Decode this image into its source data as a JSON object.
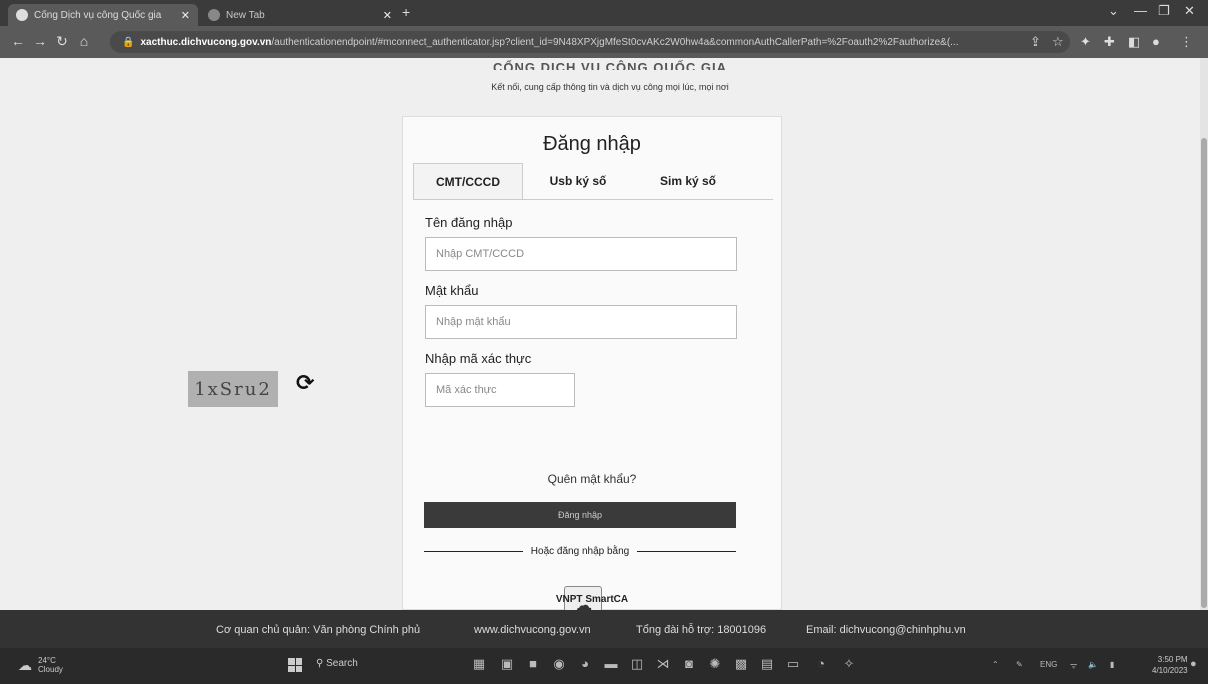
{
  "browser": {
    "tabs": [
      {
        "title": "Cổng Dịch vụ công Quốc gia",
        "close": "✕"
      },
      {
        "title": "New Tab",
        "close": "✕"
      }
    ],
    "new_tab": "+",
    "url_host": "xacthuc.dichvucong.gov.vn",
    "url_path": "/authenticationendpoint/#mconnect_authenticator.jsp?client_id=9N48XPXjgMfeSt0cvAKc2W0hw4a&commonAuthCallerPath=%2Foauth2%2Fauthorize&(..."
  },
  "page": {
    "site_name_partial": "CỔNG DỊCH VỤ CÔNG QUỐC GIA",
    "tagline": "Kết nối, cung cấp thông tin và dịch vụ công mọi lúc, mọi nơi"
  },
  "login": {
    "title": "Đăng nhập",
    "tabs": [
      "CMT/CCCD",
      "Usb ký số",
      "Sim ký số"
    ],
    "username_label": "Tên đăng nhập",
    "username_placeholder": "Nhập CMT/CCCD",
    "password_label": "Mật khẩu",
    "password_placeholder": "Nhập mật khẩu",
    "captcha_label": "Nhập mã xác thực",
    "captcha_placeholder": "Mã xác thực",
    "captcha_text": "1xSru2",
    "forgot_label": "Quên mật khẩu?",
    "submit_label": "Đăng nhập",
    "or_label": "Hoặc đăng nhập bằng",
    "alt_provider_label": "VNPT SmartCA"
  },
  "footer": {
    "agency": "Cơ quan chủ quản: Văn phòng Chính phủ",
    "website": "www.dichvucong.gov.vn",
    "hotline": "Tổng đài hỗ trợ: 18001096",
    "email": "Email: dichvucong@chinhphu.vn"
  },
  "taskbar": {
    "temperature": "24°C",
    "weather": "Cloudy",
    "search_label": "Search",
    "lang": "ENG",
    "time": "3:50 PM",
    "date": "4/10/2023"
  }
}
